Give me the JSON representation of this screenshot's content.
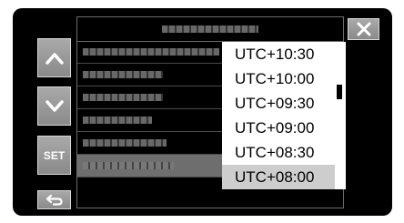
{
  "header": {
    "title": ""
  },
  "side_buttons": {
    "up_icon": "chevron-up-icon",
    "down_icon": "chevron-down-icon",
    "set_label": "SET",
    "back_icon": "return-arrow-icon",
    "close_icon": "close-icon"
  },
  "menu": {
    "items": [
      {
        "label": ""
      },
      {
        "label": ""
      },
      {
        "label": ""
      },
      {
        "label": ""
      },
      {
        "label": ""
      },
      {
        "label": ""
      }
    ],
    "selected_index": 5
  },
  "dropdown": {
    "options": [
      "UTC+10:30",
      "UTC+10:00",
      "UTC+09:30",
      "UTC+09:00",
      "UTC+08:30",
      "UTC+08:00"
    ],
    "selected": "UTC+08:00"
  },
  "colors": {
    "background": "#000000",
    "button": "#9a9a9a",
    "selected_row": "#6e6e6e",
    "dropdown_bg": "#ffffff",
    "dropdown_selected": "#cdcdcd"
  }
}
